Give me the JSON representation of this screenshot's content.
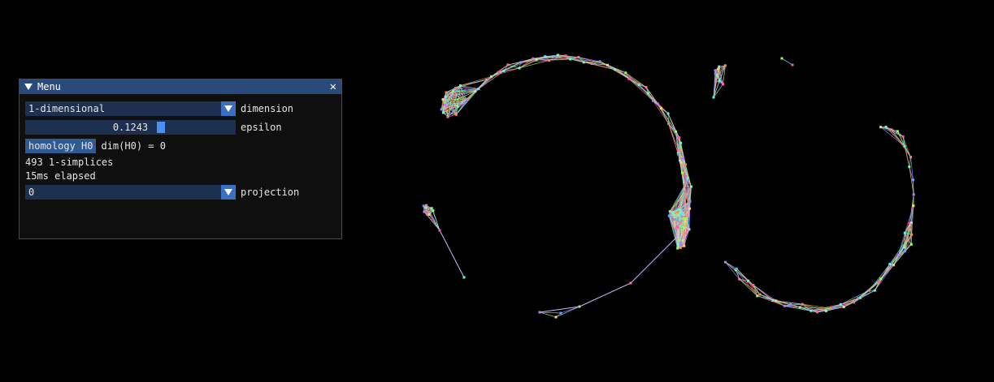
{
  "window": {
    "title": "Menu",
    "dimension": {
      "value": "1-dimensional",
      "label": "dimension"
    },
    "epsilon": {
      "value": "0.1243",
      "label": "epsilon",
      "fraction": 0.65
    },
    "homology": {
      "button_label": "homology H0",
      "result": "dim(H0) = 0"
    },
    "stats": {
      "simplices": "493 1-simplices",
      "elapsed": "15ms elapsed"
    },
    "projection": {
      "value": "0",
      "label": "projection"
    }
  },
  "colors": {
    "title_bar": "#294a7a",
    "frame": "#1d304f",
    "accent": "#4a8ff2",
    "button": "#2f5a92"
  }
}
